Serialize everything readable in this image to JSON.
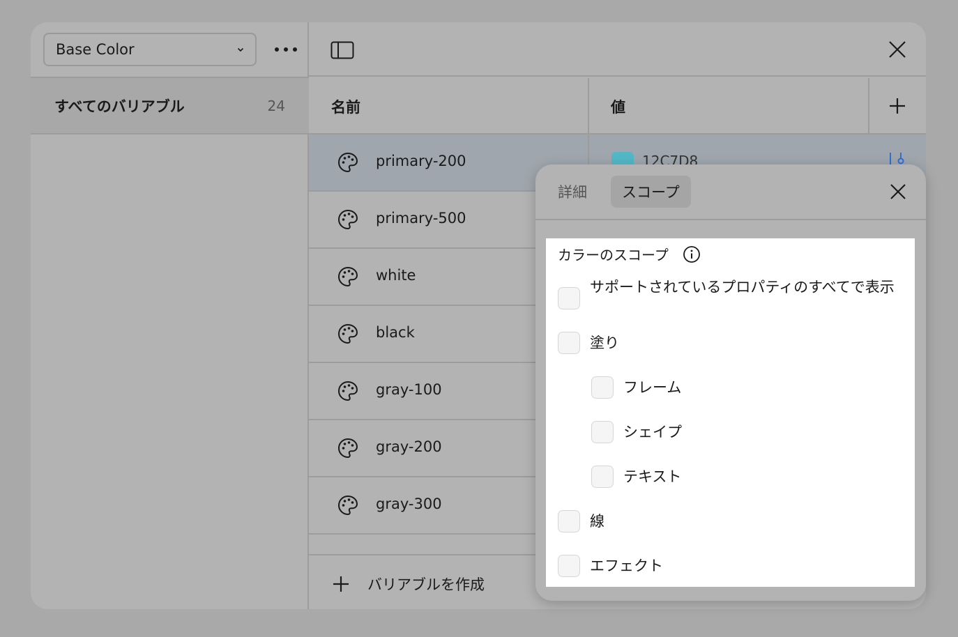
{
  "sidebar": {
    "collection_label": "Base Color",
    "group": {
      "label": "すべてのバリアブル",
      "count": "24"
    }
  },
  "table": {
    "header_name": "名前",
    "header_value": "値",
    "rows": [
      {
        "name": "primary-200",
        "value": "12C7D8"
      },
      {
        "name": "primary-500"
      },
      {
        "name": "white"
      },
      {
        "name": "black"
      },
      {
        "name": "gray-100"
      },
      {
        "name": "gray-200"
      },
      {
        "name": "gray-300"
      }
    ],
    "create_label": "バリアブルを作成"
  },
  "popover": {
    "tab_details": "詳細",
    "tab_scope": "スコープ",
    "scope_title": "カラーのスコープ",
    "options": {
      "all": "サポートされているプロパティのすべてで表示",
      "fill": "塗り",
      "frame": "フレーム",
      "shape": "シェイプ",
      "text": "テキスト",
      "stroke": "線",
      "effect": "エフェクト"
    }
  },
  "colors": {
    "swatch": "#12C7D8",
    "accent": "#2D6FD6"
  }
}
